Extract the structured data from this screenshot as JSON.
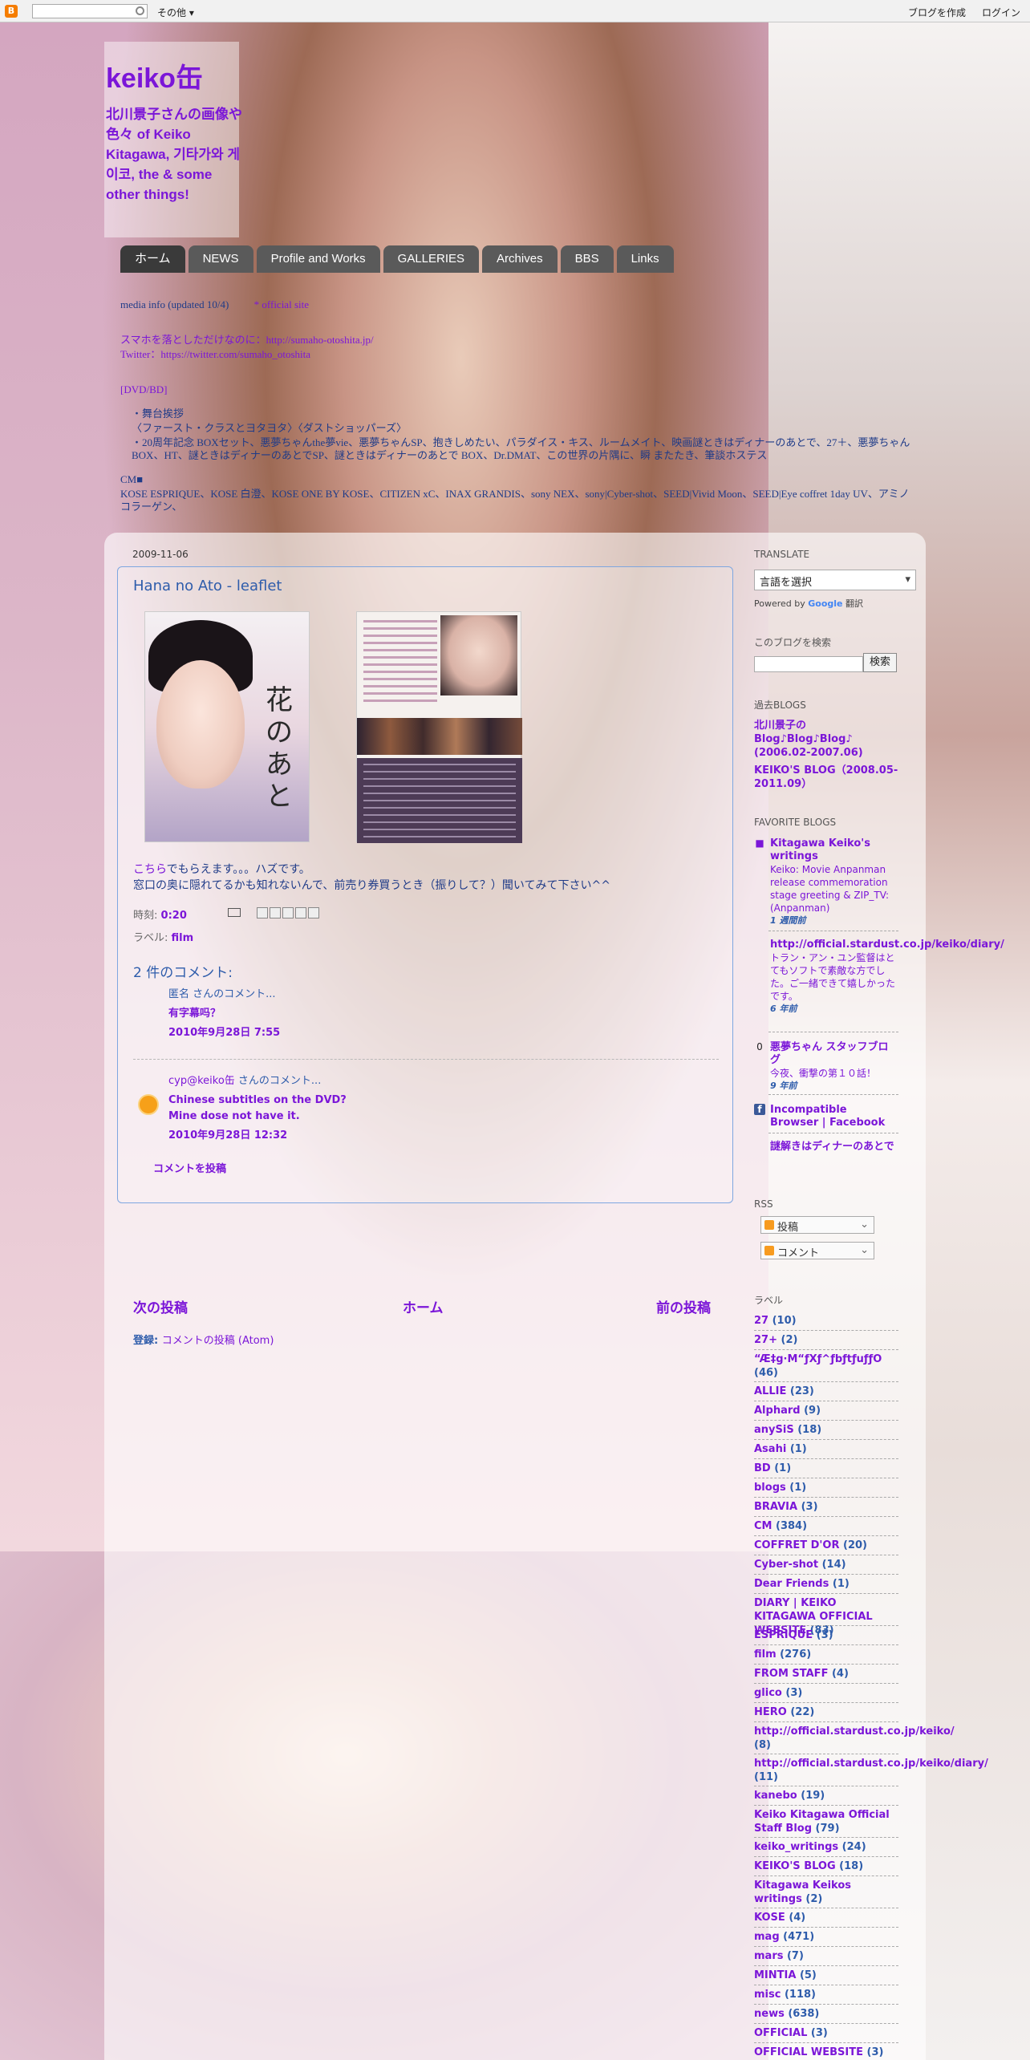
{
  "navbar": {
    "more": "その他 ▾",
    "create_blog": "ブログを作成",
    "login": "ログイン"
  },
  "header": {
    "title": "keiko缶",
    "description": "北川景子さんの画像や色々 of Keiko Kitagawa, 기타가와 게이코, the & some other things!"
  },
  "tabs": [
    "ホーム",
    "NEWS",
    "Profile and Works",
    "GALLERIES",
    "Archives",
    "BBS",
    "Links"
  ],
  "info": {
    "line1": "media info (updated 10/4)",
    "line1_link": "* official site",
    "line2": "スマホを落としただけなのに：http://sumaho-otoshita.jp/",
    "line3": "Twitter：https://twitter.com/sumaho_otoshita",
    "line4": "[DVD/BD]",
    "line5": "・舞台挨拶",
    "line6": "〈ファースト・クラスとヨタヨタ〉〈ダストショッパーズ〉",
    "line7": "・20周年記念 BOXセット、悪夢ちゃんthe夢vie、悪夢ちゃんSP、抱きしめたい、パラダイス・キス、ルームメイト、映画謎ときはディナーのあとで、27＋、悪夢ちゃん BOX、HT、謎ときはディナーのあとでSP、謎ときはディナーのあとで BOX、Dr.DMAT、この世界の片隅に、瞬 またたき、筆談ホステス",
    "line8": "CM■",
    "line9": "KOSE ESPRIQUE、KOSE 白澄、KOSE ONE BY KOSE、CITIZEN xC、INAX GRANDIS、sony NEX、sony|Cyber-shot、SEED|Vivid Moon、SEED|Eye coffret 1day UV、アミノコラーゲン、"
  },
  "post": {
    "date": "2009-11-06",
    "title": "Hana no Ato - leaflet",
    "poster_kanji": "花のあと",
    "body_link": "こちら",
    "body_line1": "でもらえます。。。ハズです。",
    "body_line2": "窓口の奥に隠れてるかも知れないんで、前売り券買うとき（振りして？）聞いてみて下さい^^",
    "time_label": "時刻:",
    "time_value": "0:20",
    "labels_label": "ラベル:",
    "labels_value": "film"
  },
  "comments": {
    "heading": "2 件のコメント:",
    "items": [
      {
        "author": "匿名 さんのコメント...",
        "text": "有字幕吗？",
        "time": "2010年9月28日 7:55"
      },
      {
        "author_link": "cyp@keiko缶",
        "author_suffix": " さんのコメント...",
        "text1": "Chinese subtitles on the DVD?",
        "text2": "Mine dose not have it.",
        "time": "2010年9月28日 12:32"
      }
    ],
    "post_link": "コメントを投稿"
  },
  "pager": {
    "newer": "次の投稿",
    "home": "ホーム",
    "older": "前の投稿",
    "subscribe_label": "登録:",
    "subscribe_link": "コメントの投稿 (Atom)"
  },
  "sidebar": {
    "translate_h": "TRANSLATE",
    "translate_select": "言語を選択",
    "powered_by": "Powered by",
    "google": "Google",
    "honyaku": "翻訳",
    "search_h": "このブログを検索",
    "search_btn": "検索",
    "past_h": "過去BLOGS",
    "past1": "北川景子の Blog♪Blog♪Blog♪ (2006.02-2007.06)",
    "past2": "KEIKO'S BLOG（2008.05-2011.09）",
    "fav_h": "FAVORITE BLOGS",
    "favs": [
      {
        "title": "Kitagawa Keiko's writings",
        "sub": "Keiko: Movie Anpanman release commemoration stage greeting & ZIP_TV: (Anpanman)",
        "ago": "1 週間前"
      },
      {
        "title": "http://official.stardust.co.jp/keiko/diary/",
        "sub": "トラン・アン・ユン監督はとてもソフトで素敵な方でした。ご一緒できて嬉しかったです。",
        "ago": "6 年前"
      },
      {
        "title": "悪夢ちゃん スタッフブログ",
        "sub": "今夜、衝撃の第１０話！",
        "ago": "9 年前"
      },
      {
        "title": "Incompatible Browser | Facebook",
        "sub": "",
        "ago": ""
      },
      {
        "title": "謎解きはディナーのあとで",
        "sub": "",
        "ago": ""
      }
    ],
    "rss_h": "RSS",
    "rss1": "投稿",
    "rss2": "コメント",
    "labels_h": "ラベル",
    "labels": [
      [
        "27",
        "(10)"
      ],
      [
        "27+",
        "(2)"
      ],
      [
        "“Æ‡g·M“ƒXƒ^ƒbƒtƒuƒƒO",
        "(46)"
      ],
      [
        "ALLIE",
        "(23)"
      ],
      [
        "Alphard",
        "(9)"
      ],
      [
        "anySiS",
        "(18)"
      ],
      [
        "Asahi",
        "(1)"
      ],
      [
        "BD",
        "(1)"
      ],
      [
        "blogs",
        "(1)"
      ],
      [
        "BRAVIA",
        "(3)"
      ],
      [
        "CM",
        "(384)"
      ],
      [
        "COFFRET D'OR",
        "(20)"
      ],
      [
        "Cyber-shot",
        "(14)"
      ],
      [
        "Dear Friends",
        "(1)"
      ],
      [
        "DIARY | KEIKO KITAGAWA OFFICIAL WEBSITE",
        "(83)"
      ],
      [
        "ESPRIQUE",
        "(3)"
      ],
      [
        "film",
        "(276)"
      ],
      [
        "FROM STAFF",
        "(4)"
      ],
      [
        "glico",
        "(3)"
      ],
      [
        "HERO",
        "(22)"
      ],
      [
        "http://official.stardust.co.jp/keiko/",
        "(8)"
      ],
      [
        "http://official.stardust.co.jp/keiko/diary/",
        "(11)"
      ],
      [
        "kanebo",
        "(19)"
      ],
      [
        "Keiko Kitagawa Official Staff Blog",
        "(79)"
      ],
      [
        "keiko_writings",
        "(24)"
      ],
      [
        "KEIKO'S BLOG",
        "(18)"
      ],
      [
        "Kitagawa Keikos writings",
        "(2)"
      ],
      [
        "KOSE",
        "(4)"
      ],
      [
        "mag",
        "(471)"
      ],
      [
        "mars",
        "(7)"
      ],
      [
        "MINTIA",
        "(5)"
      ],
      [
        "misc",
        "(118)"
      ],
      [
        "news",
        "(638)"
      ],
      [
        "OFFICIAL",
        "(3)"
      ],
      [
        "OFFICIAL WEBSITE",
        "(3)"
      ]
    ]
  }
}
